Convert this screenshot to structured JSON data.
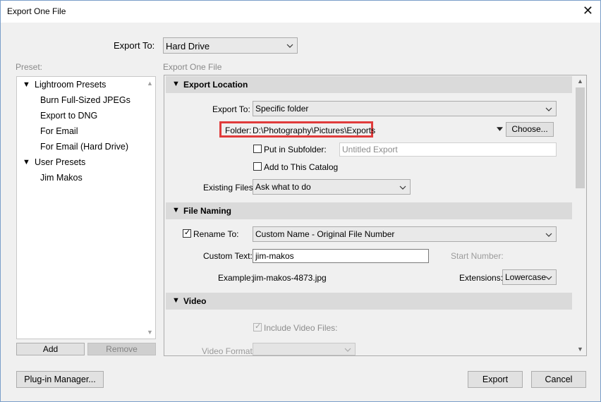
{
  "window": {
    "title": "Export One File",
    "close_glyph": "✕"
  },
  "export_to": {
    "label": "Export To:",
    "value": "Hard Drive"
  },
  "preset": {
    "label": "Preset:",
    "groups": [
      {
        "name": "Lightroom Presets",
        "items": [
          "Burn Full-Sized JPEGs",
          "Export to DNG",
          "For Email",
          "For Email (Hard Drive)"
        ]
      },
      {
        "name": "User Presets",
        "items": [
          "Jim Makos"
        ]
      }
    ],
    "add_label": "Add",
    "remove_label": "Remove"
  },
  "panel_title": "Export One File",
  "export_location": {
    "header": "Export Location",
    "export_to_label": "Export To:",
    "export_to_value": "Specific folder",
    "folder_label": "Folder:",
    "folder_path": "D:\\Photography\\Pictures\\Exports",
    "choose_label": "Choose...",
    "subfolder_label": "Put in Subfolder:",
    "subfolder_placeholder": "Untitled Export",
    "add_catalog_label": "Add to This Catalog",
    "existing_files_label": "Existing Files:",
    "existing_files_value": "Ask what to do"
  },
  "file_naming": {
    "header": "File Naming",
    "rename_label": "Rename To:",
    "rename_value": "Custom Name - Original File Number",
    "custom_text_label": "Custom Text:",
    "custom_text_value": "jim-makos",
    "start_number_label": "Start Number:",
    "example_label": "Example:",
    "example_value": "jim-makos-4873.jpg",
    "extensions_label": "Extensions:",
    "extensions_value": "Lowercase"
  },
  "video": {
    "header": "Video",
    "include_label": "Include Video Files:",
    "format_label": "Video Format:"
  },
  "footer": {
    "plugin_manager_label": "Plug-in Manager...",
    "export_label": "Export",
    "cancel_label": "Cancel"
  },
  "colors": {
    "highlight_border": "#e03b3b",
    "section_bg": "#dadada"
  }
}
